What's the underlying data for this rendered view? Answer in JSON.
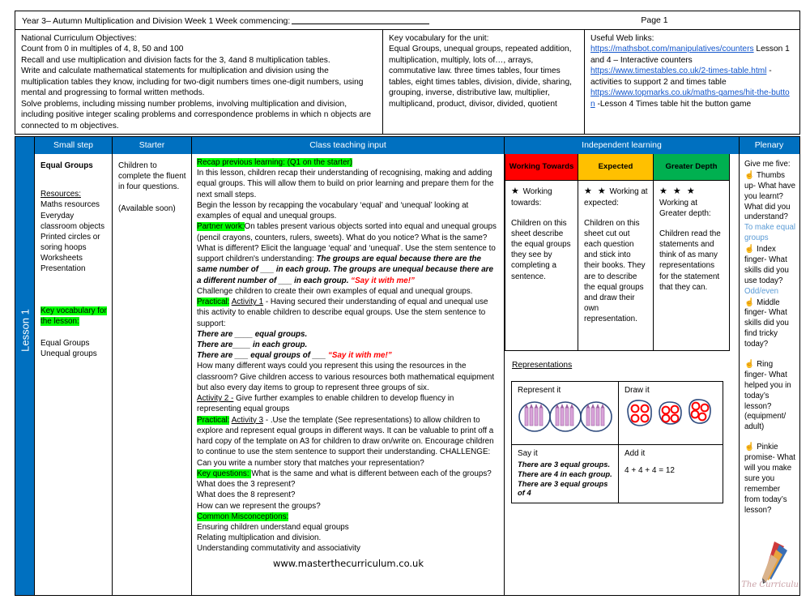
{
  "header": {
    "title": "Year 3– Autumn Multiplication and Division Week 1   Week  commencing:",
    "page_label": "Page 1"
  },
  "info": {
    "nc_heading": "National Curriculum Objectives:",
    "nc_lines": [
      "Count from 0 in multiples of 4, 8, 50 and 100",
      "Recall and use multiplication and division facts for the 3, 4and 8 multiplication tables.",
      "Write and calculate mathematical statements for multiplication and division using the multiplication tables they know, including for two-digit numbers times one-digit numbers, using mental and progressing to formal written methods.",
      "Solve problems, including missing number problems, involving multiplication and division, including positive integer scaling problems and correspondence problems in which n objects are connected to m objectives."
    ],
    "vocab_heading": "Key vocabulary for the unit:",
    "vocab_body": " Equal Groups, unequal groups, repeated addition, multiplication, multiply, lots of…, arrays, commutative law. three times tables, four times tables, eight times tables, division, divide, sharing, grouping, inverse, distributive law, multiplier, multiplicand, product, divisor, divided, quotient",
    "links_heading": "Useful Web links:",
    "links": [
      {
        "url": "https://mathsbot.com/manipulatives/counters",
        "note": " Lesson 1 and 4 – Interactive counters"
      },
      {
        "url": "https://www.timestables.co.uk/2-times-table.html",
        "note": " - activities to support 2 and  times table"
      },
      {
        "url": "https://www.topmarks.co.uk/maths-games/hit-the-button",
        "note": " -Lesson 4 Times table hit the button game"
      }
    ]
  },
  "columns": {
    "small_step": "Small step",
    "starter": "Starter",
    "class_input": "Class teaching input",
    "independent": "Independent learning",
    "plenary": "Plenary"
  },
  "lesson_tab": "Lesson 1",
  "small_step": {
    "title": "Equal Groups",
    "resources_heading": "Resources:",
    "resources": "Maths resources Everyday classroom objects Printed circles or soring hoops Worksheets Presentation",
    "vocab_heading": "Key vocabulary for the lesson:",
    "vocab_items": "Equal Groups Unequal groups"
  },
  "starter": {
    "text": "Children to complete the fluent in four questions.",
    "availability": "(Available soon)"
  },
  "class_input": {
    "recap_tag": "Recap previous learning: (Q1 on the starter)",
    "p1": "In this lesson, children recap their understanding of recognising, making and adding equal groups. This will allow them to build on prior learning and prepare them for the next small steps.",
    "p2": "Begin the lesson by recapping the vocabulary ‘equal’ and ‘unequal’ looking at examples of equal and unequal groups.",
    "partner_tag": "Partner work:",
    "p3": "On tables present various objects sorted into equal and unequal groups (pencil crayons, counters, rulers, sweets). What do you notice?  What is the same? What is different?  Elicit the language ‘equal’ and ‘unequal’.  Use the stem sentence to support children's understanding:  ",
    "stem1": "The groups are equal because there are the same number of ___ in each group.  The groups are unequal because there are a different number of ___ in each group.  ",
    "say_it_1": "“Say it with me!”",
    "p4": "Challenge children to create their own examples of equal and unequal groups.",
    "practical_tag_1": "Practical:",
    "activity1_label": "Activity 1",
    "p5": " -  Having secured their understanding of  equal and unequal use this activity to enable children to describe equal groups.  Use the stem sentence to support:",
    "stem_a": "There are ____  equal groups.",
    "stem_b": "There are____  in each group.",
    "stem_c": "There are ___  equal groups of ___",
    "say_it_2": "“Say it with me!”",
    "p6": "How many different ways could you represent this using the resources in the classroom?  Give children access to various resources both mathematical equipment but also every day items to group to represent three groups of six.",
    "activity2_label": "Activity 2 -",
    "p7": " Give further examples to enable children to develop fluency in representing equal groups",
    "practical_tag_2": "Practical:",
    "activity3_label": "Activity 3",
    "p8": " - .Use the template (See representations)  to allow children to explore and represent equal groups in different ways.  It can be valuable to print off a hard copy of the template on A3 for children to draw on/write on. Encourage children to continue to use the stem sentence to support their understanding.  CHALLENGE: Can you write a number  story that matches your representation?",
    "key_questions_tag": " Key questions: ",
    "kq1": " What is the same and what is different between each of the groups?",
    "kq2": "What does the 3 represent?",
    "kq3": "What does the 8 represent?",
    "kq4": "How can we represent the groups?",
    "misconceptions_tag": "Common Misconceptions:",
    "mis1": "Ensuring children understand equal groups",
    "mis2": "Relating multiplication and division.",
    "mis3": "Understanding commutativity and associativity",
    "website": "www.masterthecurriculum.co.uk"
  },
  "independent": {
    "bands": [
      {
        "label": "Working Towards",
        "color": "#FF0000",
        "stars": "★",
        "heading": "Working towards:",
        "body": "Children on this sheet describe the equal groups they see by completing a sentence."
      },
      {
        "label": "Expected",
        "color": "#FFC000",
        "stars": "★ ★",
        "heading": "Working at expected:",
        "body": "Children on this sheet cut out each question and stick into their books. They are to describe the equal groups and draw their own representation."
      },
      {
        "label": "Greater Depth",
        "color": "#00B050",
        "stars": "★ ★ ★",
        "heading": "Working at Greater depth:",
        "body": "Children read the statements and think of as many representations for the statement that they can."
      }
    ],
    "representations_title": "Representations",
    "reps": {
      "represent_it_label": "Represent it",
      "draw_it_label": "Draw it",
      "say_it_label": "Say it",
      "say_it_lines": [
        "There are 3 equal groups.",
        "There are 4 in each group.",
        "There are 3 equal groups of 4"
      ],
      "add_it_label": "Add it",
      "add_it_value": "4 + 4 + 4  = 12"
    }
  },
  "plenary": {
    "title": "Give me five:",
    "items": [
      {
        "prompt": "Thumbs up- What have you learnt? What did you understand?",
        "answer": "To make equal groups"
      },
      {
        "prompt": "Index finger- What skills did you use today?",
        "answer": "Odd/even"
      },
      {
        "prompt": "Middle finger- What skills did you find tricky today?",
        "answer": ""
      },
      {
        "prompt": "Ring finger- What helped you in today’s lesson? (equipment/ adult)",
        "answer": ""
      },
      {
        "prompt": "Pinkie promise- What will you make sure you remember from today’s lesson?",
        "answer": ""
      }
    ]
  },
  "logo": {
    "script_text": "Master The Curriculum"
  }
}
